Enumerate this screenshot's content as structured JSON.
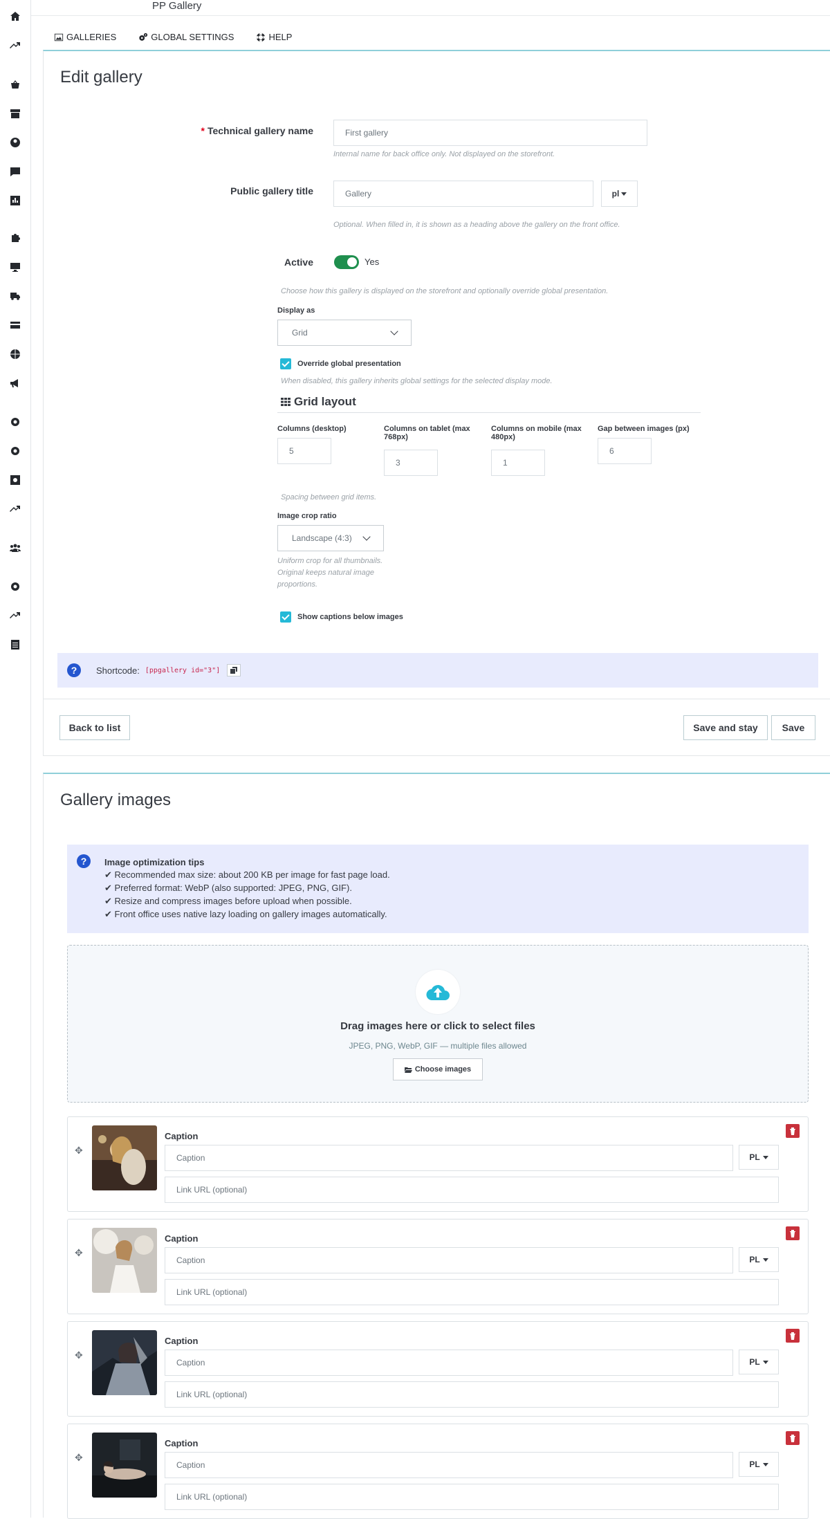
{
  "header": {
    "app_title": "PP Gallery"
  },
  "tabs": [
    {
      "label": "GALLERIES",
      "icon": "image-icon"
    },
    {
      "label": "GLOBAL SETTINGS",
      "icon": "cogs-icon"
    },
    {
      "label": "HELP",
      "icon": "life-ring-icon"
    }
  ],
  "edit": {
    "title": "Edit gallery",
    "technical_name": {
      "label": "Technical gallery name",
      "value": "First gallery",
      "hint": "Internal name for back office only. Not displayed on the storefront."
    },
    "public_title": {
      "label": "Public gallery title",
      "value": "Gallery",
      "lang": "pl",
      "hint": "Optional. When filled in, it is shown as a heading above the gallery on the front office."
    },
    "active": {
      "label": "Active",
      "value": "Yes",
      "on": true
    },
    "display_hint": "Choose how this gallery is displayed on the storefront and optionally override global presentation.",
    "display_as": {
      "label": "Display as",
      "value": "Grid"
    },
    "override": {
      "label": "Override global presentation",
      "checked": true,
      "hint": "When disabled, this gallery inherits global settings for the selected display mode."
    },
    "grid": {
      "heading": "Grid layout",
      "columns_desktop": {
        "label": "Columns (desktop)",
        "value": "5"
      },
      "columns_tablet": {
        "label_1": "Columns on tablet (max",
        "label_2": "768px)",
        "value": "3"
      },
      "columns_mobile": {
        "label_1": "Columns on mobile (max",
        "label_2": "480px)",
        "value": "1"
      },
      "gap": {
        "label": "Gap between images (px)",
        "value": "6"
      },
      "spacing_hint": "Spacing between grid items."
    },
    "crop": {
      "label": "Image crop ratio",
      "value": "Landscape (4:3)",
      "hint_1": "Uniform crop for all thumbnails.",
      "hint_2": "Original keeps natural image",
      "hint_3": "proportions."
    },
    "captions": {
      "label": "Show captions below images",
      "checked": true
    },
    "shortcode": {
      "label": "Shortcode:",
      "code": "[ppgallery id=\"3\"]"
    },
    "back_label": "Back to list",
    "save_stay_label": "Save and stay",
    "save_label": "Save"
  },
  "images": {
    "title": "Gallery images",
    "tips": {
      "title": "Image optimization tips",
      "items": [
        "Recommended max size: about 200 KB per image for fast page load.",
        "Preferred format: WebP (also supported: JPEG, PNG, GIF).",
        "Resize and compress images before upload when possible.",
        "Front office uses native lazy loading on gallery images automatically."
      ]
    },
    "dropzone": {
      "title": "Drag images here or click to select files",
      "subtitle": "JPEG, PNG, WebP, GIF — multiple files allowed",
      "button": "Choose images"
    },
    "items": [
      {
        "caption_label": "Caption",
        "caption_placeholder": "Caption",
        "lang": "PL",
        "link_placeholder": "Link URL (optional)"
      },
      {
        "caption_label": "Caption",
        "caption_placeholder": "Caption",
        "lang": "PL",
        "link_placeholder": "Link URL (optional)"
      },
      {
        "caption_label": "Caption",
        "caption_placeholder": "Caption",
        "lang": "PL",
        "link_placeholder": "Link URL (optional)"
      },
      {
        "caption_label": "Caption",
        "caption_placeholder": "Caption",
        "lang": "PL",
        "link_placeholder": "Link URL (optional)"
      }
    ]
  },
  "colors": {
    "accent": "#25b9d7",
    "toggle_on": "#1f8f4e",
    "info_bg": "#e8ebfd",
    "danger": "#c8313b"
  }
}
